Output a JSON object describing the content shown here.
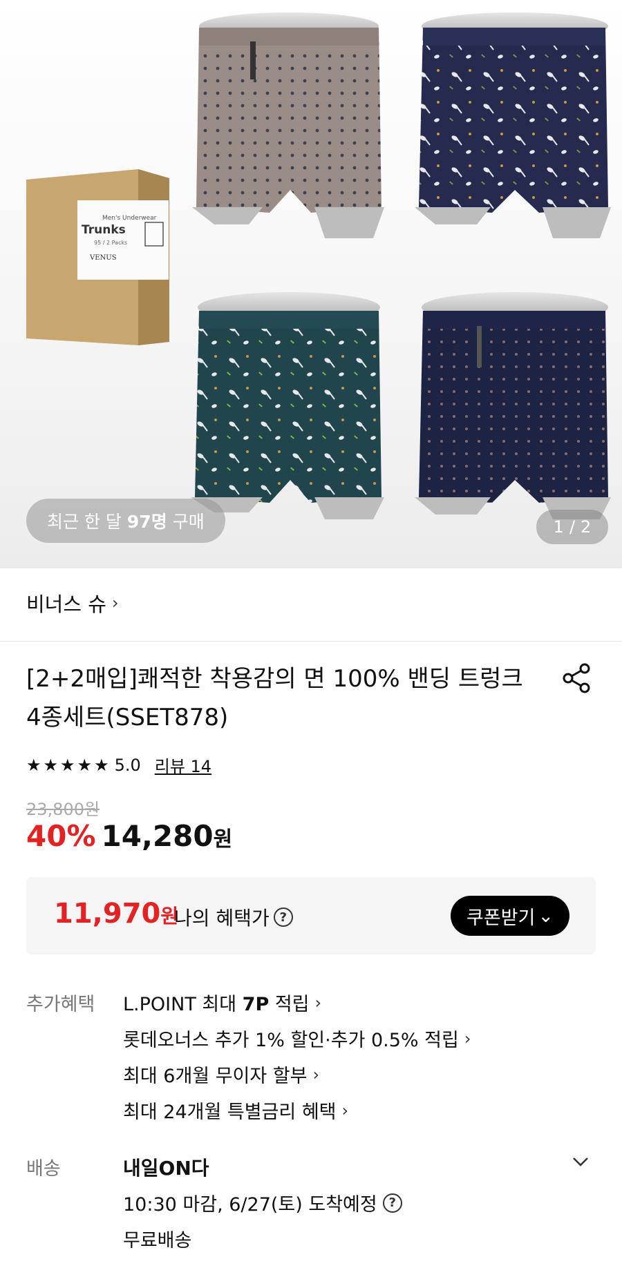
{
  "hero": {
    "box_label": {
      "line1": "Men's Underwear",
      "line2": "Trunks",
      "line3": "95 / 2 Packs",
      "brand": "VENUS"
    },
    "recent_purchase": {
      "prefix": "최근 한 달",
      "count": "97명",
      "suffix": "구매"
    },
    "pager": {
      "current": "1",
      "separator": "/",
      "total": "2"
    }
  },
  "brand": {
    "name": "비너스 슈",
    "chevron": "›"
  },
  "product": {
    "title": "[2+2매입]쾌적한 착용감의 면 100% 밴딩 트렁크 4종세트(SSET878)",
    "rating": "5.0",
    "stars": [
      "★",
      "★",
      "★",
      "★",
      "★"
    ],
    "review_link": "리뷰 14",
    "original_price": "23,800원",
    "discount": "40%",
    "price": "14,280",
    "won": "원"
  },
  "benefit_box": {
    "price": "11,970",
    "won": "원",
    "label": "나의 혜택가",
    "help_icon": "?",
    "coupon_button": "쿠폰받기",
    "coupon_chevron": "⌄"
  },
  "extra_benefits": {
    "label": "추가혜택",
    "items": [
      {
        "pre": "L.POINT 최대 ",
        "bold": "7P",
        "post": " 적립"
      },
      {
        "pre": "롯데오너스 추가 1% 할인·추가 0.5% 적립",
        "bold": "",
        "post": ""
      },
      {
        "pre": "최대 6개월 무이자 할부",
        "bold": "",
        "post": ""
      },
      {
        "pre": "최대 24개월 특별금리 혜택",
        "bold": "",
        "post": ""
      }
    ],
    "chevron": "›"
  },
  "shipping": {
    "label": "배송",
    "title": "내일ON다",
    "deadline": "10:30 마감, 6/27(토) 도착예정",
    "help_icon": "?",
    "fee": "무료배송"
  },
  "colors": {
    "accent_red": "#e32323",
    "text": "#111111",
    "muted": "#777777",
    "box_bg": "#f5f5f5"
  }
}
